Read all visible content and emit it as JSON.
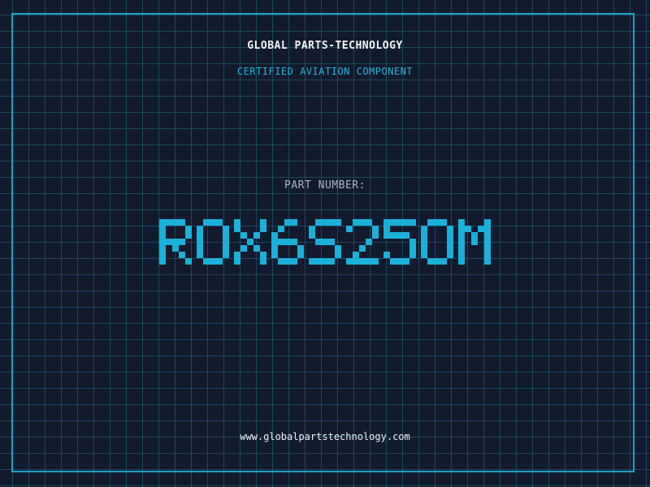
{
  "header": {
    "brand": "GLOBAL PARTS-TECHNOLOGY",
    "tagline": "CERTIFIED AVIATION COMPONENT"
  },
  "part": {
    "label": "PART NUMBER:",
    "number": "ROX6S250M"
  },
  "footer": {
    "url": "www.globalpartstechnology.com"
  },
  "colors": {
    "background": "#121a2d",
    "grid": "#206e84",
    "frame": "#1aa3c8",
    "accent": "#1ab0d8",
    "brand_text": "#f2f4f7",
    "label_text": "#a9b4c4"
  }
}
